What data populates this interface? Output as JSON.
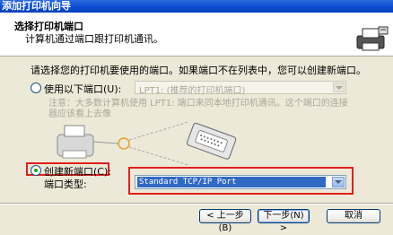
{
  "window": {
    "title": "添加打印机向导"
  },
  "header": {
    "title": "选择打印机端口",
    "subtitle": "计算机通过端口跟打印机通讯。",
    "icon": "printer-port-icon"
  },
  "prompt": "请选择您的打印机要使用的端口。如果端口不在列表中，您可以创建新端口。",
  "use_existing": {
    "label": "使用以下端口(U):",
    "selected": false,
    "select_value": "LPT1: (推荐的打印机端口)",
    "note": "注意：大多数计算机使用 LPT1: 端口来同本地打印机通讯。这个端口的连接器应该看上去像"
  },
  "create_new": {
    "label": "创建新端口(C):",
    "selected": true,
    "type_label": "端口类型:",
    "select_value": "Standard TCP/IP Port"
  },
  "buttons": {
    "back": "< 上一步(B)",
    "next": "下一步(N) >",
    "cancel": "取消"
  },
  "colors": {
    "highlight_red": "#E0201B",
    "title_blue": "#0A4BD0",
    "selection_blue": "#316AC5"
  }
}
